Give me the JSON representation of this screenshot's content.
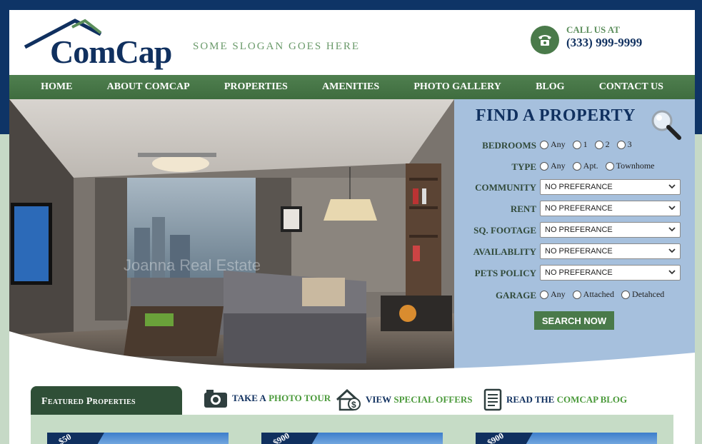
{
  "header": {
    "logo_text": "ComCap",
    "slogan": "SOME SLOGAN GOES HERE",
    "call_label": "CALL US AT",
    "call_number": "(333) 999-9999",
    "icons": {
      "phone": "phone-icon"
    }
  },
  "nav": {
    "items": [
      {
        "label": "HOME"
      },
      {
        "label": "ABOUT COMCAP"
      },
      {
        "label": "PROPERTIES"
      },
      {
        "label": "AMENITIES"
      },
      {
        "label": "PHOTO GALLERY"
      },
      {
        "label": "BLOG"
      },
      {
        "label": "CONTACT US"
      }
    ]
  },
  "search": {
    "title": "FIND A PROPERTY",
    "bedrooms": {
      "label": "BEDROOMS",
      "options": [
        "Any",
        "1",
        "2",
        "3"
      ]
    },
    "type": {
      "label": "TYPE",
      "options": [
        "Any",
        "Apt.",
        "Townhome"
      ]
    },
    "community": {
      "label": "COMMUNITY",
      "value": "NO PREFERANCE"
    },
    "rent": {
      "label": "RENT",
      "value": "NO PREFERANCE"
    },
    "sqfootage": {
      "label": "SQ. FOOTAGE",
      "value": "NO PREFERANCE"
    },
    "availability": {
      "label": "AVAILABLITY",
      "value": "NO PREFERANCE"
    },
    "pets": {
      "label": "PETS POLICY",
      "value": "NO PREFERANCE"
    },
    "garage": {
      "label": "GARAGE",
      "options": [
        "Any",
        "Attached",
        "Detahced"
      ]
    },
    "button": "SEARCH NOW"
  },
  "hero": {
    "watermark": "Joanna Real Estate"
  },
  "featured": {
    "tab": "Featured Properties",
    "links": [
      {
        "prefix": "TAKE A ",
        "highlight": "PHOTO TOUR"
      },
      {
        "prefix": "VIEW ",
        "highlight": "SPECIAL OFFERS"
      },
      {
        "prefix": "READ THE ",
        "highlight": "COMCAP BLOG"
      }
    ],
    "cards": [
      {
        "price": "$50"
      },
      {
        "price": "$900"
      },
      {
        "price": "$900"
      }
    ]
  },
  "colors": {
    "navy": "#10305f",
    "green": "#4a7a4a",
    "panel_blue": "#a6c0dd",
    "accent_green": "#4b9a3b"
  }
}
